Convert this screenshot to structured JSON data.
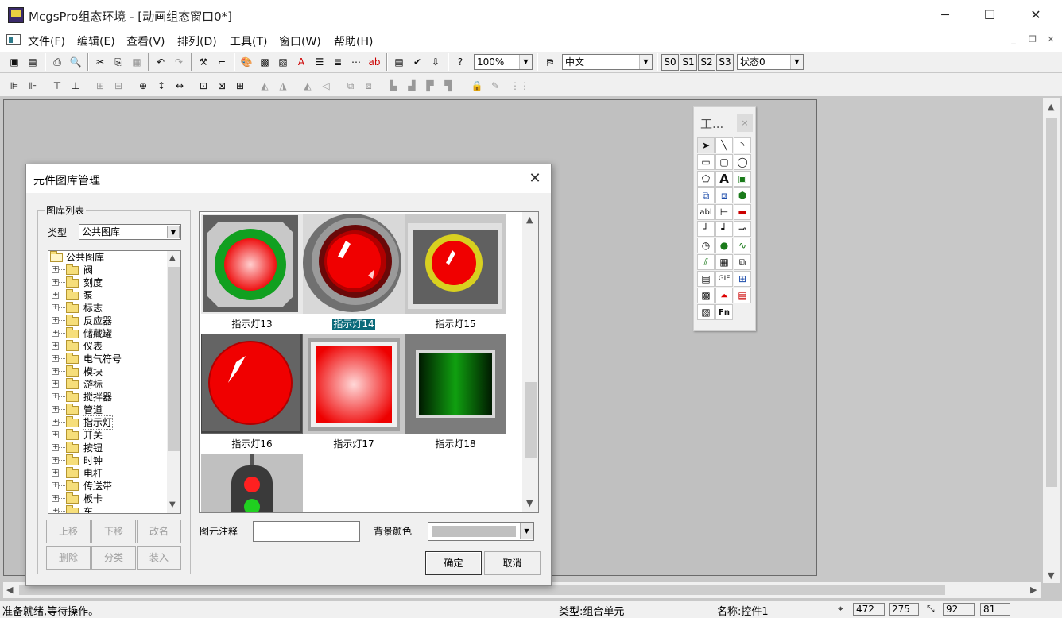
{
  "window": {
    "title": "McgsPro组态环境 - [动画组态窗口0*]",
    "minimize": "─",
    "maximize": "☐",
    "close": "✕"
  },
  "menu": [
    "文件(F)",
    "编辑(E)",
    "查看(V)",
    "排列(D)",
    "工具(T)",
    "窗口(W)",
    "帮助(H)"
  ],
  "toolbar": {
    "zoom": "100%",
    "language": "中文",
    "states": [
      "S0",
      "S1",
      "S2",
      "S3"
    ],
    "state_select": "状态0",
    "text_buttons": {
      "a": "A",
      "abl": "abl",
      "fn": "Fn",
      "gif": "GIF"
    }
  },
  "toolbox": {
    "title": "工...",
    "close": "×"
  },
  "dialog": {
    "title": "元件图库管理",
    "close": "✕",
    "group_title": "图库列表",
    "type_label": "类型",
    "type_value": "公共图库",
    "tree_root": "公共图库",
    "tree_items": [
      "阀",
      "刻度",
      "泵",
      "标志",
      "反应器",
      "储藏罐",
      "仪表",
      "电气符号",
      "模块",
      "游标",
      "搅拌器",
      "管道",
      "指示灯",
      "开关",
      "按钮",
      "时钟",
      "电杆",
      "传送带",
      "板卡",
      "车"
    ],
    "buttons_row1": [
      "上移",
      "下移",
      "改名"
    ],
    "buttons_row2": [
      "删除",
      "分类",
      "装入"
    ],
    "gallery": [
      "指示灯13",
      "指示灯14",
      "指示灯15",
      "指示灯16",
      "指示灯17",
      "指示灯18"
    ],
    "selected_item": "指示灯14",
    "note_label": "图元注释",
    "note_value": "",
    "bg_label": "背景颜色",
    "ok": "确定",
    "cancel": "取消"
  },
  "status": {
    "message": "准备就绪,等待操作。",
    "type": "类型:组合单元",
    "name": "名称:控件1",
    "x": "472",
    "y": "275",
    "w": "92",
    "h": "81"
  },
  "colors": {
    "indicator_red": "#ff1a1a",
    "indicator_green": "#11a020",
    "selection": "#0a6a7a",
    "canvas": "#c0c0c0"
  }
}
